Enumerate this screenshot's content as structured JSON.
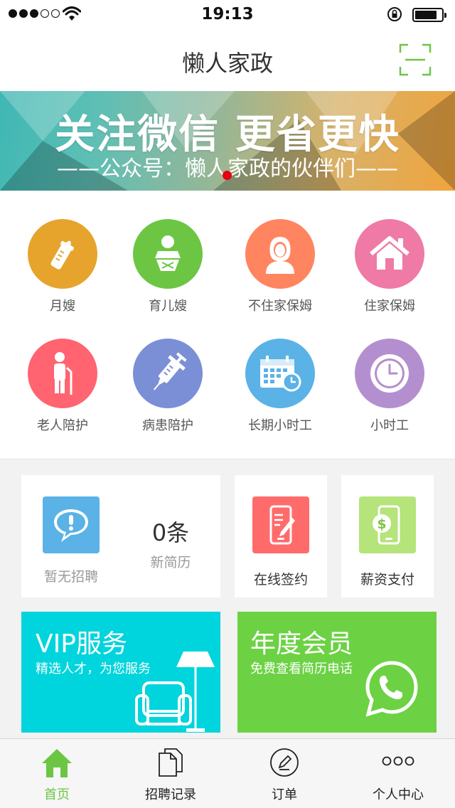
{
  "status_bar": {
    "time": "19:13",
    "signal_dots_filled": 3,
    "signal_dots_total": 5,
    "icons": [
      "wifi-icon",
      "rotation-lock-icon",
      "battery-icon"
    ]
  },
  "header": {
    "title": "懒人家政",
    "scan_icon": "scan-icon",
    "accent": "#6cc644"
  },
  "banner": {
    "headline": "关注微信  更省更快",
    "subline": "——公众号：懒人家政的伙伴们——",
    "indicator_color": "#e60012"
  },
  "services": [
    {
      "label": "月嫂",
      "icon": "baby-bottle-icon",
      "color": "#e6a42c"
    },
    {
      "label": "育儿嫂",
      "icon": "baby-icon",
      "color": "#6cc644"
    },
    {
      "label": "不住家保姆",
      "icon": "woman-icon",
      "color": "#ff8561"
    },
    {
      "label": "住家保姆",
      "icon": "house-icon",
      "color": "#ee7aa5"
    },
    {
      "label": "老人陪护",
      "icon": "elderly-icon",
      "color": "#ff6470"
    },
    {
      "label": "病患陪护",
      "icon": "syringe-icon",
      "color": "#7b8fd6"
    },
    {
      "label": "长期小时工",
      "icon": "calendar-icon",
      "color": "#5ab2e6"
    },
    {
      "label": "小时工",
      "icon": "clock-icon",
      "color": "#b48fcf"
    }
  ],
  "recruit_card": {
    "status": "暂无招聘",
    "resume_count": "0条",
    "resume_label": "新简历",
    "icon": "message-alert-icon",
    "icon_color": "#5ab2e6"
  },
  "sign_card": {
    "label": "在线签约",
    "icon": "phone-sign-icon",
    "icon_color": "#ff6b6b"
  },
  "pay_card": {
    "label": "薪资支付",
    "icon": "phone-dollar-icon",
    "icon_color": "#b5e47a"
  },
  "vip_promo": {
    "title": "VIP服务",
    "subtitle": "精选人才，为您服务",
    "color": "#00d4dc",
    "icon": "armchair-lamp-icon"
  },
  "member_promo": {
    "title": "年度会员",
    "subtitle": "免费查看简历电话",
    "color": "#6cd244",
    "icon": "phone-chat-icon"
  },
  "tab_bar": {
    "tabs": [
      {
        "label": "首页",
        "icon": "home-icon",
        "active": true
      },
      {
        "label": "招聘记录",
        "icon": "documents-icon",
        "active": false
      },
      {
        "label": "订单",
        "icon": "pen-circle-icon",
        "active": false
      },
      {
        "label": "个人中心",
        "icon": "more-dots-icon",
        "active": false
      }
    ],
    "active_color": "#6cc644"
  }
}
